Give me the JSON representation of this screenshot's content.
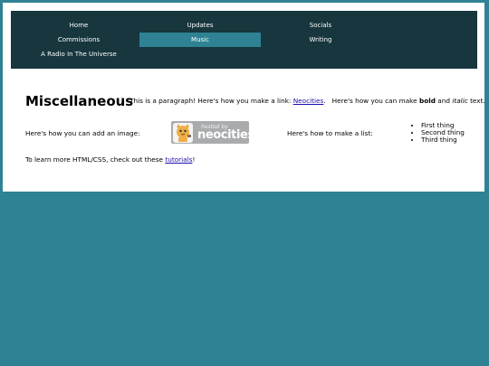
{
  "nav": {
    "items": [
      {
        "label": "Home"
      },
      {
        "label": "Updates"
      },
      {
        "label": "Socials"
      },
      {
        "label": "Commissions"
      },
      {
        "label": "Music",
        "active": true
      },
      {
        "label": "Writing"
      },
      {
        "label": "A Radio In The Universe"
      }
    ]
  },
  "header": {
    "title": "Miscellaneous",
    "para_start": "This is a paragraph! Here's how you make a link: ",
    "link_text": "Neocities",
    "para_mid": ".   Here's how you can make ",
    "bold_text": "bold",
    "and_text": " and ",
    "italic_text": "italic",
    "para_end": " text."
  },
  "image_section": {
    "label": "Here's how you can add an image:",
    "badge": {
      "small": "hosted by",
      "brand": "neocities"
    }
  },
  "list_section": {
    "label": "Here's how to make a list:",
    "items": [
      "First thing",
      "Second thing",
      "Third thing"
    ]
  },
  "footer": {
    "text_start": "To learn more HTML/CSS, check out these ",
    "link_text": "tutorials",
    "text_end": "!"
  },
  "colors": {
    "background": "#2e8294",
    "nav_bg": "#17363e",
    "nav_active": "#2e8294",
    "link": "#1a0dab"
  }
}
